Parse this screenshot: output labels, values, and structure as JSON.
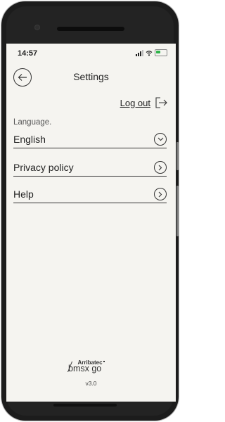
{
  "status": {
    "time": "14:57"
  },
  "header": {
    "title": "Settings"
  },
  "account": {
    "logout_label": "Log out"
  },
  "language": {
    "label": "Language.",
    "selected": "English"
  },
  "menu": [
    {
      "label": "Privacy policy"
    },
    {
      "label": "Help"
    }
  ],
  "footer": {
    "brand": "Arribatec",
    "product": "bmsx go",
    "version": "v3.0"
  },
  "colors": {
    "screen_bg": "#f5f4f0",
    "frame": "#1c1c1c",
    "text": "#222222",
    "battery": "#2fb34a"
  },
  "icons": [
    "back-arrow-icon",
    "logout-icon",
    "chevron-down-icon",
    "chevron-right-icon",
    "signal-icon",
    "wifi-icon",
    "battery-icon"
  ]
}
